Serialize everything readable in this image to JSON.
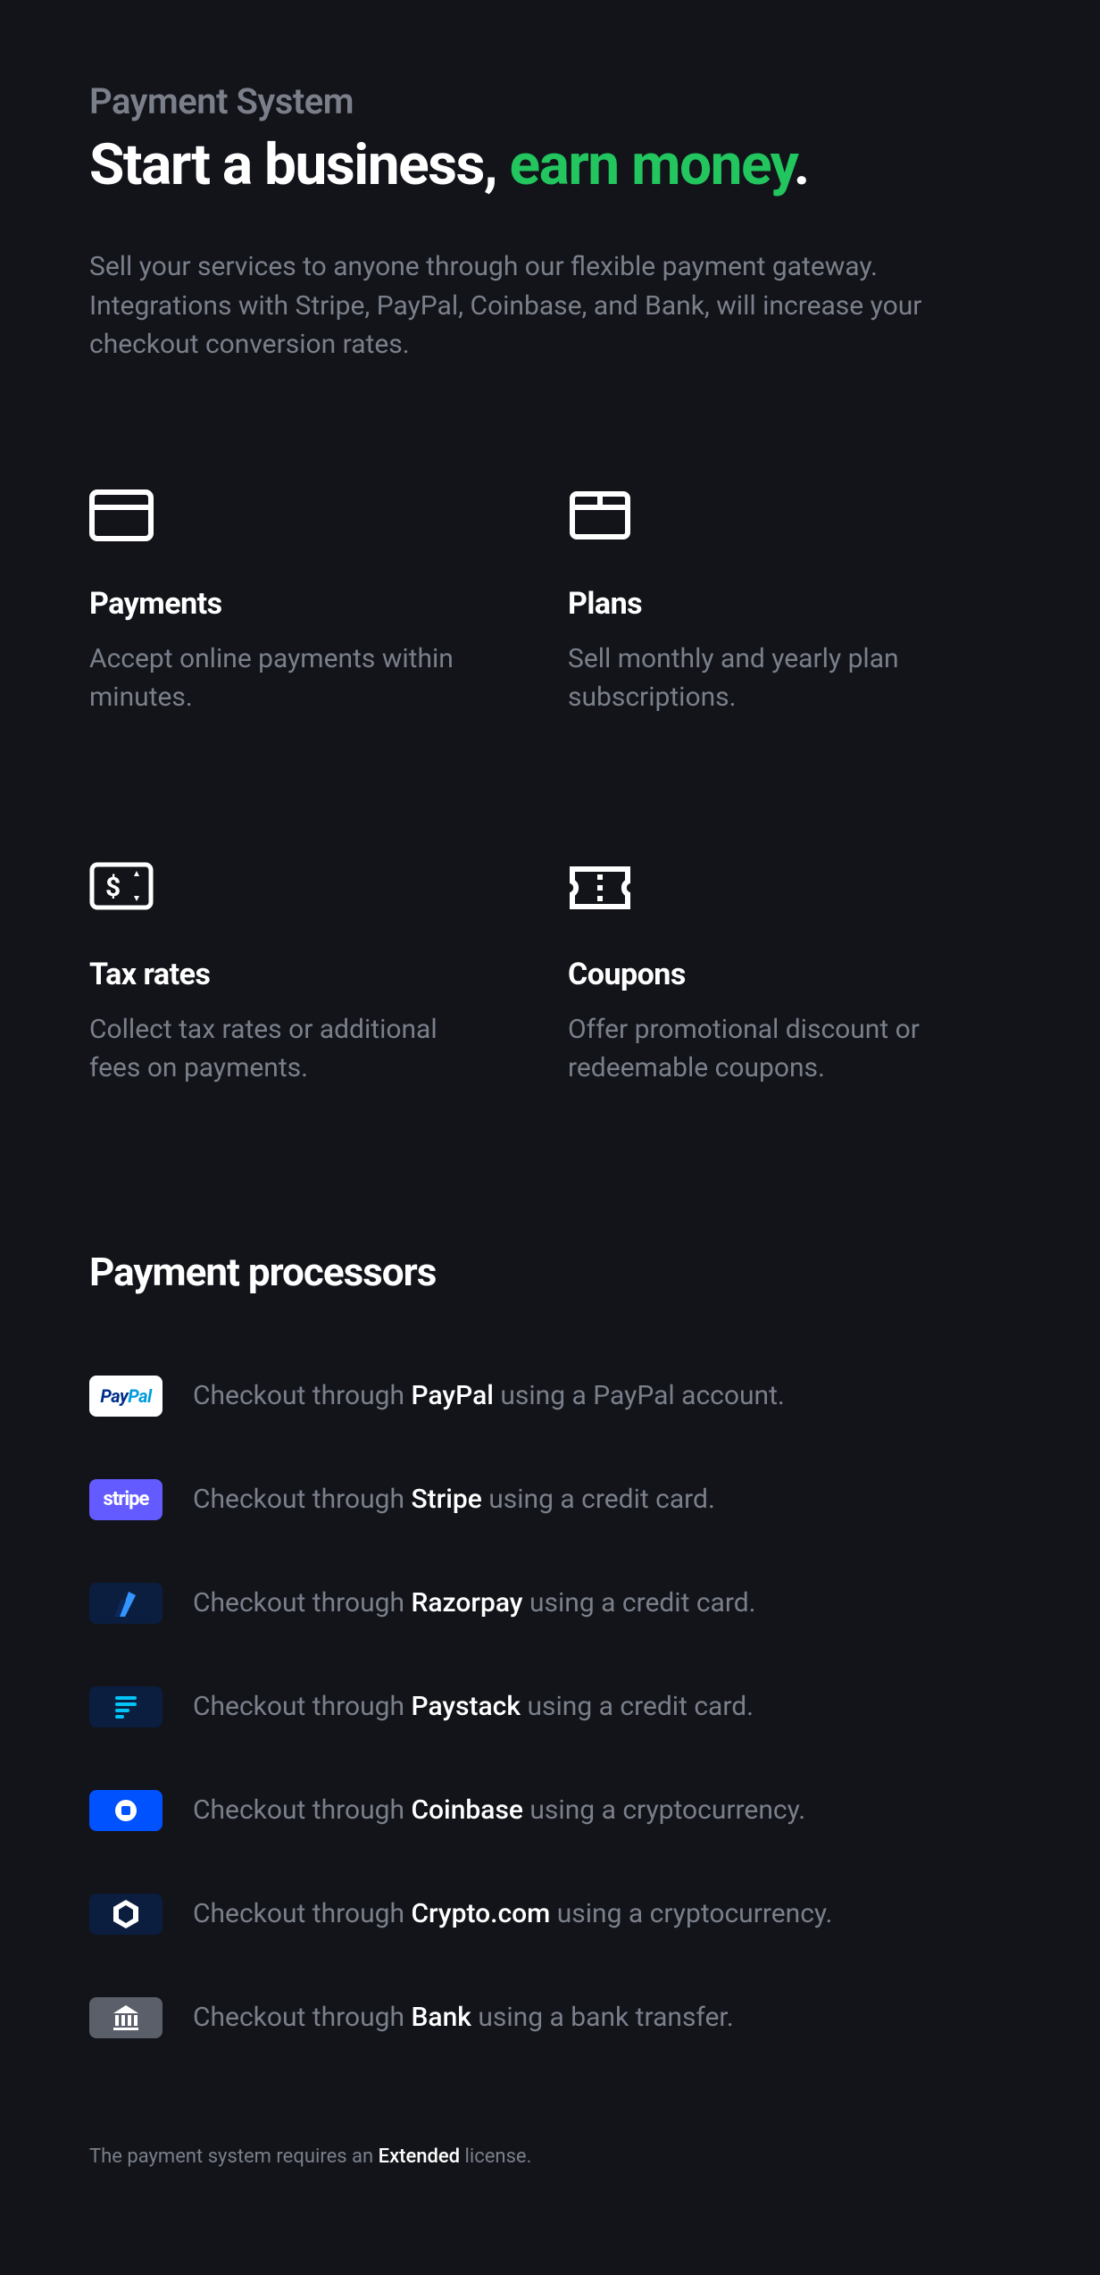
{
  "header": {
    "eyebrow": "Payment System",
    "headline_pre": "Start a business, ",
    "headline_accent": "earn money",
    "headline_post": ".",
    "lead": "Sell your services to anyone through our flexible payment gateway. Integrations with Stripe, PayPal, Coinbase, and Bank, will increase your checkout conversion rates."
  },
  "features": [
    {
      "title": "Payments",
      "desc": "Accept online payments within minutes."
    },
    {
      "title": "Plans",
      "desc": "Sell monthly and yearly plan subscriptions."
    },
    {
      "title": "Tax rates",
      "desc": "Collect tax rates or additional fees on payments."
    },
    {
      "title": "Coupons",
      "desc": "Offer promotional discount or redeemable coupons."
    }
  ],
  "processors_title": "Payment processors",
  "processors": [
    {
      "name": "PayPal",
      "pre": "Checkout through ",
      "post": " using a PayPal account."
    },
    {
      "name": "Stripe",
      "pre": "Checkout through ",
      "post": " using a credit card."
    },
    {
      "name": "Razorpay",
      "pre": "Checkout through ",
      "post": " using a credit card."
    },
    {
      "name": "Paystack",
      "pre": "Checkout through ",
      "post": " using a credit card."
    },
    {
      "name": "Coinbase",
      "pre": "Checkout through ",
      "post": " using a cryptocurrency."
    },
    {
      "name": "Crypto.com",
      "pre": "Checkout through ",
      "post": " using a cryptocurrency."
    },
    {
      "name": "Bank",
      "pre": "Checkout through ",
      "post": " using a bank transfer."
    }
  ],
  "footnote": {
    "pre": "The payment system requires an ",
    "strong": "Extended",
    "post": " license."
  }
}
